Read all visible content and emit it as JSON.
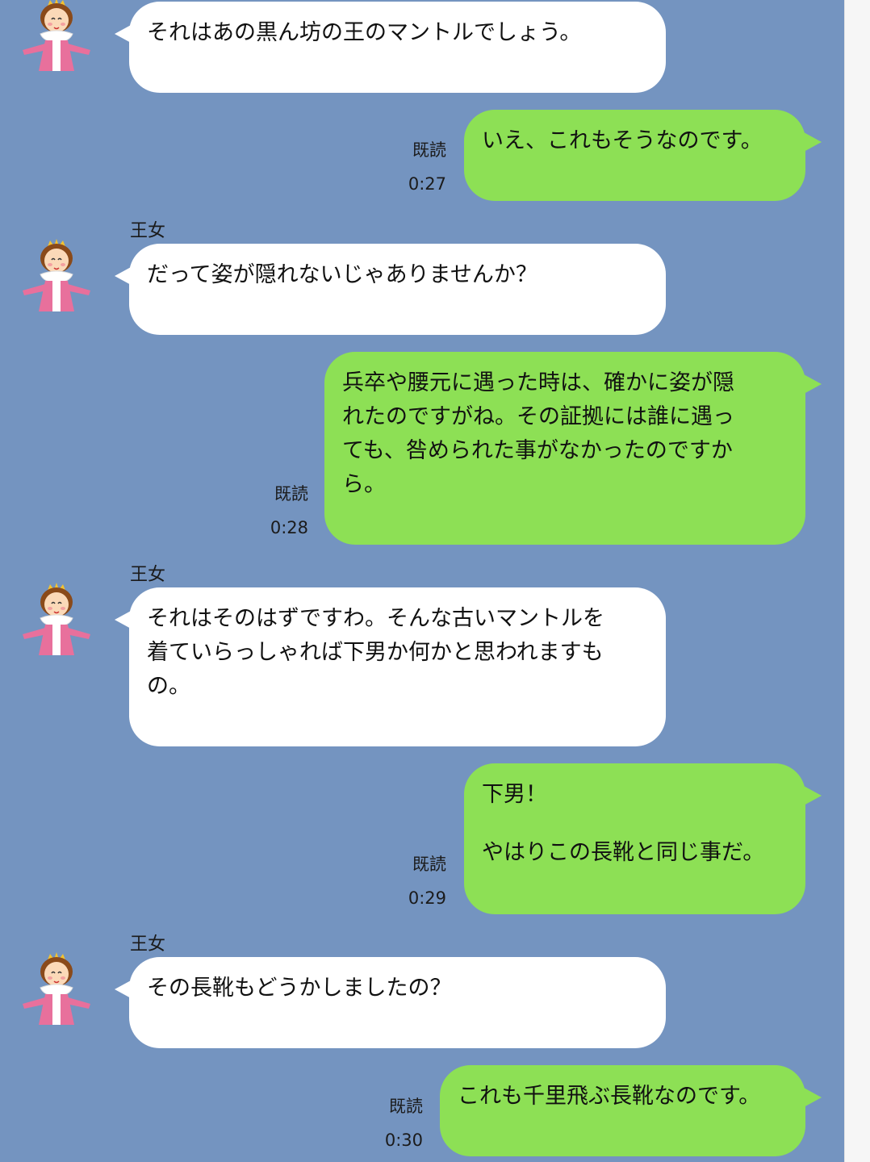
{
  "sender_name": "王女",
  "read_label": "既読",
  "messages": [
    {
      "from": "princess",
      "lines": [
        "それはあの黒ん坊の王のマントルでしょう。"
      ]
    },
    {
      "from": "me",
      "lines": [
        "いえ、これもそうなのです。"
      ],
      "time": "0:27"
    },
    {
      "from": "princess",
      "lines": [
        "だって姿が隠れないじゃありませんか？"
      ]
    },
    {
      "from": "me",
      "lines": [
        "兵卒や腰元に遇った時は、確かに姿が隠",
        "れたのですがね。その証拠には誰に遇っ",
        "ても、咎められた事がなかったのですか",
        "ら。"
      ],
      "time": "0:28"
    },
    {
      "from": "princess",
      "lines": [
        "それはそのはずですわ。そんな古いマントルを",
        "着ていらっしゃれば下男か何かと思われますも",
        "の。"
      ]
    },
    {
      "from": "me",
      "lines": [
        "下男！",
        "",
        "やはりこの長靴と同じ事だ。"
      ],
      "time": "0:29"
    },
    {
      "from": "princess",
      "lines": [
        "その長靴もどうかしましたの？"
      ]
    },
    {
      "from": "me",
      "lines": [
        "これも千里飛ぶ長靴なのです。"
      ],
      "time": "0:30"
    }
  ]
}
